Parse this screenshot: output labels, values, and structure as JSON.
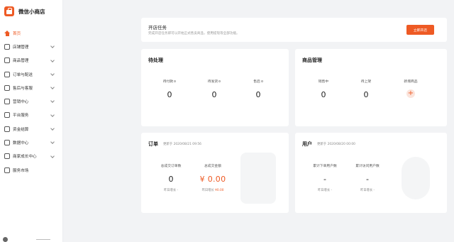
{
  "brand": {
    "name": "微信小商店"
  },
  "sidebar": {
    "items": [
      {
        "label": "首页",
        "active": true,
        "icon": "home-icon"
      },
      {
        "label": "店铺管理",
        "icon": "store-icon"
      },
      {
        "label": "商品管理",
        "icon": "goods-icon"
      },
      {
        "label": "订单与配送",
        "icon": "order-icon"
      },
      {
        "label": "售后与客服",
        "icon": "service-icon"
      },
      {
        "label": "营销中心",
        "icon": "marketing-icon"
      },
      {
        "label": "平台服务",
        "icon": "platform-icon"
      },
      {
        "label": "资金结算",
        "icon": "finance-icon"
      },
      {
        "label": "数据中心",
        "icon": "data-icon"
      },
      {
        "label": "商家成长中心",
        "icon": "growth-icon"
      },
      {
        "label": "服务市场",
        "icon": "market-icon"
      }
    ]
  },
  "task": {
    "title": "开店任务",
    "desc": "完成开店任务即可以开始正式售卖商品，使用提现等全部功能。",
    "button": "立即开店"
  },
  "pending": {
    "title": "待处理",
    "stats": [
      {
        "label": "待付款",
        "value": "0"
      },
      {
        "label": "待发货",
        "value": "0"
      },
      {
        "label": "售后",
        "value": "0"
      }
    ]
  },
  "goods": {
    "title": "商品管理",
    "stats": [
      {
        "label": "销售中",
        "value": "0"
      },
      {
        "label": "待上架",
        "value": "0"
      }
    ],
    "new_label": "新增商品",
    "new_symbol": "+"
  },
  "orders": {
    "title": "订单",
    "update": "更新于 2020/08/21 09:56",
    "stats": [
      {
        "label": "总成交订单数",
        "value": "0",
        "yday_label": "昨日增长",
        "yday_value": "-"
      },
      {
        "label": "总成交金额",
        "value": "¥ 0.00",
        "yday_label": "昨日增长",
        "yday_value": "¥0.00"
      }
    ]
  },
  "users": {
    "title": "用户",
    "update": "更新于 2020/08/20 00:00",
    "stats": [
      {
        "label": "累计下单用户数",
        "value": "-",
        "yday_label": "昨日增长",
        "yday_value": "-"
      },
      {
        "label": "累计访问用户数",
        "value": "-",
        "yday_label": "昨日增长",
        "yday_value": "-"
      }
    ]
  },
  "colors": {
    "accent": "#ee5a24",
    "background": "#f2f3f5"
  }
}
